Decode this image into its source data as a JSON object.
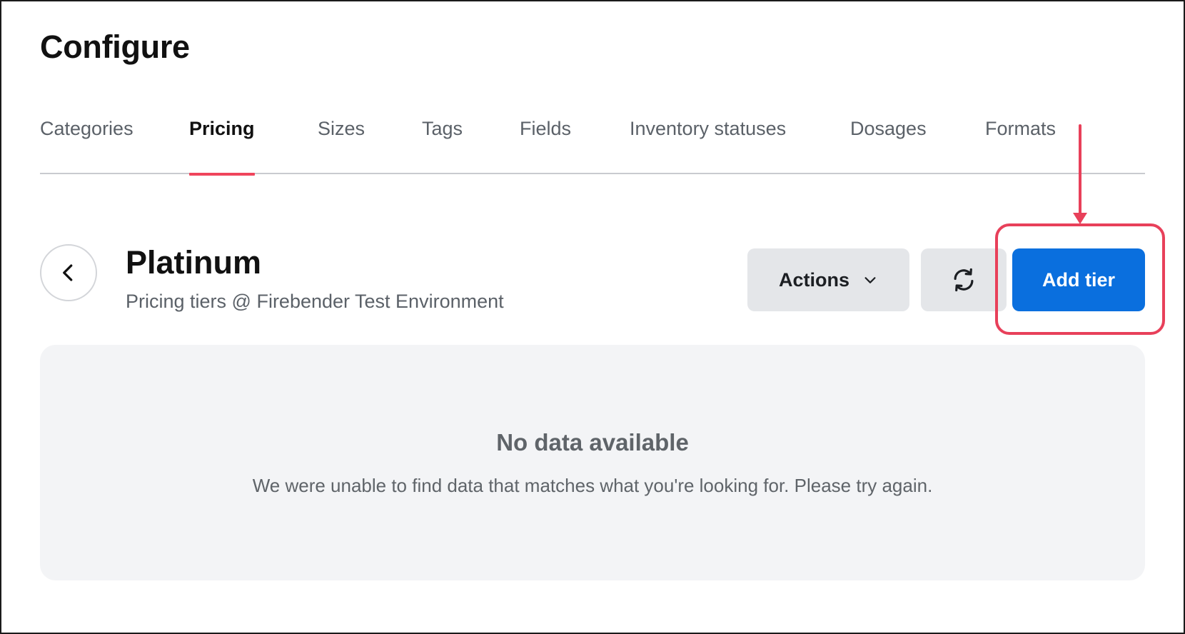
{
  "page": {
    "title": "Configure"
  },
  "tabs": [
    {
      "label": "Categories",
      "active": false
    },
    {
      "label": "Pricing",
      "active": true
    },
    {
      "label": "Sizes",
      "active": false
    },
    {
      "label": "Tags",
      "active": false
    },
    {
      "label": "Fields",
      "active": false
    },
    {
      "label": "Inventory statuses",
      "active": false
    },
    {
      "label": "Dosages",
      "active": false
    },
    {
      "label": "Formats",
      "active": false
    }
  ],
  "header": {
    "back_icon": "chevron-left-icon",
    "title": "Platinum",
    "subtitle": "Pricing tiers @ Firebender Test Environment"
  },
  "toolbar": {
    "actions_label": "Actions",
    "actions_icon": "chevron-down-icon",
    "refresh_icon": "refresh-icon",
    "add_label": "Add tier"
  },
  "empty_state": {
    "title": "No data available",
    "message": "We were unable to find data that matches what you're looking for. Please try again."
  },
  "colors": {
    "accent": "#f0455c",
    "primary_button": "#0a6fde",
    "secondary_button": "#e4e6e9",
    "annotation": "#e8405a",
    "panel_bg": "#f3f4f6"
  }
}
